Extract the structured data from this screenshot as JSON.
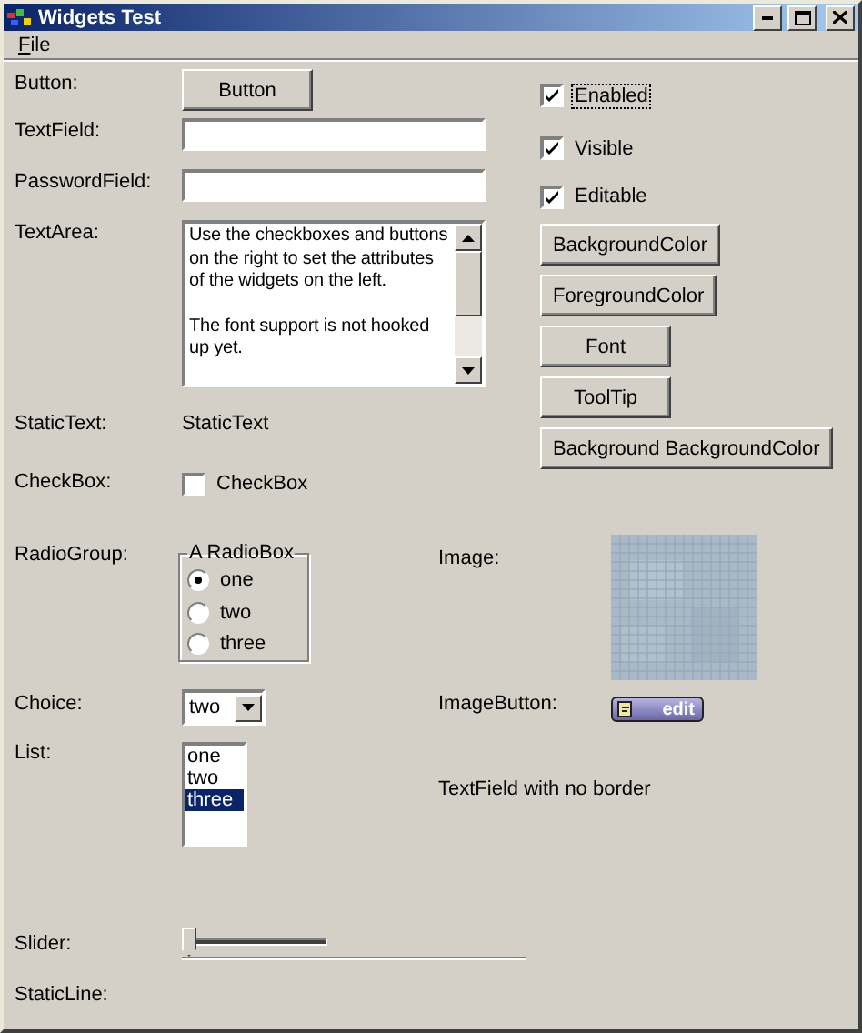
{
  "window": {
    "title": "Widgets Test"
  },
  "menu": [
    {
      "label": "File"
    }
  ],
  "form": {
    "button": {
      "label": "Button:",
      "text": "Button"
    },
    "text_field": {
      "label": "TextField:"
    },
    "password_field": {
      "label": "PasswordField:"
    },
    "text_area": {
      "label": "TextArea:",
      "paragraphs": [
        "Use the checkboxes and buttons on the right to set the attributes of the widgets on the left.",
        "The font support is not hooked up yet."
      ]
    },
    "static_text": {
      "label": "StaticText:",
      "text": "StaticText"
    },
    "check_box": {
      "label": "CheckBox:",
      "text": "CheckBox",
      "checked": false
    },
    "radio_group": {
      "label": "RadioGroup:",
      "title": "A RadioBox",
      "options": [
        {
          "label": "one",
          "selected": true
        },
        {
          "label": "two",
          "selected": false
        },
        {
          "label": "three",
          "selected": false
        }
      ]
    },
    "image": {
      "label": "Image:"
    },
    "choice": {
      "label": "Choice:",
      "value": "two"
    },
    "image_button": {
      "label": "ImageButton:",
      "text": "edit"
    },
    "list": {
      "label": "List:",
      "items": [
        {
          "label": "one",
          "selected": false
        },
        {
          "label": "two",
          "selected": false
        },
        {
          "label": "three",
          "selected": true
        }
      ]
    },
    "borderless_field": {
      "value": "TextField with no border"
    },
    "slider": {
      "label": "Slider:",
      "level": 0
    },
    "static_line": {
      "label": "StaticLine:"
    }
  },
  "settings": {
    "checkboxes": [
      {
        "label": "Enabled",
        "checked": true,
        "focused": true
      },
      {
        "label": "Visible",
        "checked": true,
        "focused": false
      },
      {
        "label": "Editable",
        "checked": true,
        "focused": false
      }
    ],
    "buttons": [
      "BackgroundColor",
      "ForegroundColor",
      "Font",
      "ToolTip",
      "Background BackgroundColor"
    ]
  }
}
